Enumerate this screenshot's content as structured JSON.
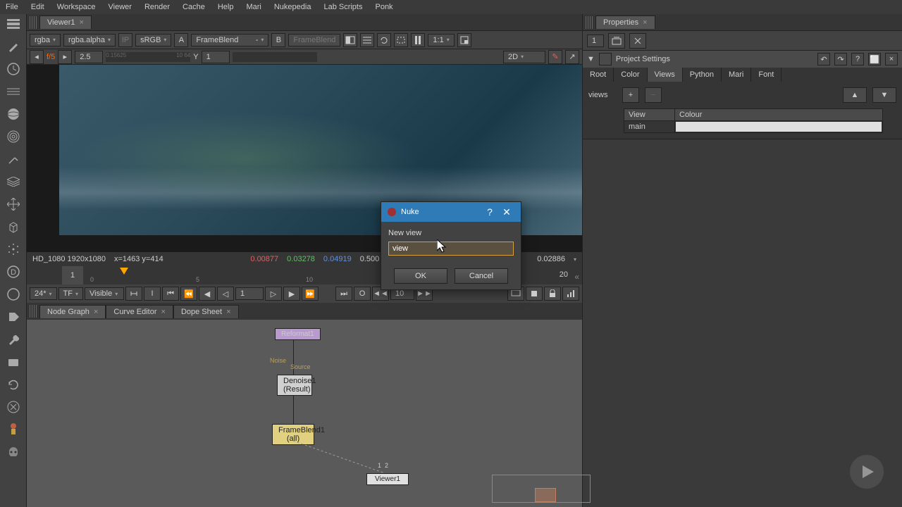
{
  "menu": [
    "File",
    "Edit",
    "Workspace",
    "Viewer",
    "Render",
    "Cache",
    "Help",
    "Mari",
    "Nukepedia",
    "Lab Scripts",
    "Ponk"
  ],
  "viewer_tab": "Viewer1",
  "properties_tab": "Properties",
  "viewer_ctrl": {
    "channel": "rgba",
    "layer": "rgba.alpha",
    "ip": "IP",
    "colorspace": "sRGB",
    "input_a": "A",
    "input_a_node": "FrameBlend",
    "input_b": "B",
    "input_b_node": "FrameBlend",
    "ratio": "1:1",
    "mode_2d": "2D"
  },
  "viewer_sub": {
    "frame_indicator": "f/5",
    "scale": "2.5",
    "y_label": "Y",
    "y_value": "1"
  },
  "info_bar": {
    "format": "HD_1080 1920x1080",
    "coords": "x=1463 y=414",
    "r": "0.00877",
    "g": "0.03278",
    "b": "0.04919",
    "a": "0.500",
    "extra": "0.02886"
  },
  "timeline": {
    "ticks": [
      "1",
      "5",
      "10",
      "20"
    ],
    "frame_0": "0"
  },
  "transport": {
    "fps": "24*",
    "tf": "TF",
    "visible": "Visible",
    "i_btn": "I",
    "current": "1",
    "o_btn": "O",
    "range": "10"
  },
  "node_tabs": [
    "Node Graph",
    "Curve Editor",
    "Dope Sheet"
  ],
  "nodes": {
    "reformat": "Reformat1",
    "noise": "Noise",
    "source": "Source",
    "denoise": "Denoise1",
    "denoise_sub": "(Result)",
    "frameblend": "FrameBlend1",
    "frameblend_sub": "(all)",
    "viewer": "Viewer1",
    "num1": "1",
    "num2": "2"
  },
  "dialog": {
    "title": "Nuke",
    "label": "New view",
    "value": "view",
    "ok": "OK",
    "cancel": "Cancel"
  },
  "props": {
    "title": "Project Settings",
    "tabs": [
      "Root",
      "Color",
      "Views",
      "Python",
      "Mari",
      "Font"
    ],
    "views_label": "views",
    "plus": "+",
    "minus": "−",
    "view_header": "View",
    "colour_header": "Colour",
    "main_row": "main",
    "input_1": "1"
  }
}
